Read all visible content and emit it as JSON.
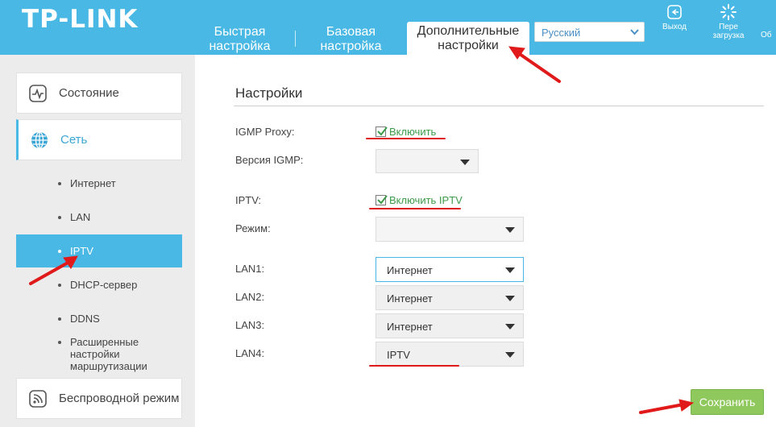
{
  "header": {
    "logo": "TP-LINK",
    "tabs": [
      {
        "label": "Быстрая настройка"
      },
      {
        "label": "Базовая настройка"
      },
      {
        "label": "Дополнительные настройки"
      }
    ],
    "language": "Русский",
    "exit_label": "Выход",
    "reboot_label": "Пере загрузка",
    "more_label": "Об"
  },
  "sidebar": {
    "status": "Состояние",
    "network": "Сеть",
    "sub_items": [
      "Интернет",
      "LAN",
      "IPTV",
      "DHCP-сервер",
      "DDNS",
      "Расширенные настройки маршрутизации"
    ],
    "wireless": "Беспроводной режим"
  },
  "content": {
    "title": "Настройки",
    "igmp_proxy_label": "IGMP Proxy:",
    "igmp_proxy_check": "Включить",
    "igmp_version_label": "Версия IGMP:",
    "igmp_version_value": "",
    "iptv_label": "IPTV:",
    "iptv_check": "Включить IPTV",
    "mode_label": "Режим:",
    "mode_value": "",
    "lan1_label": "LAN1:",
    "lan1_value": "Интернет",
    "lan2_label": "LAN2:",
    "lan2_value": "Интернет",
    "lan3_label": "LAN3:",
    "lan3_value": "Интернет",
    "lan4_label": "LAN4:",
    "lan4_value": "IPTV",
    "save": "Сохранить"
  },
  "colors": {
    "header": "#4ab8e4",
    "active": "#4ab8e4",
    "save": "#8fc85c",
    "check_text": "#3d9b4a",
    "annotation": "#e01a1a"
  }
}
